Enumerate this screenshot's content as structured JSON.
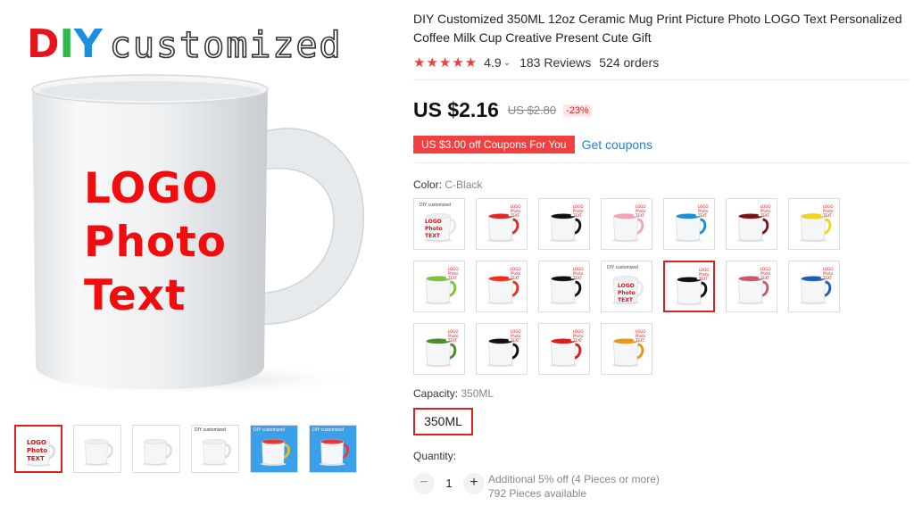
{
  "gallery": {
    "banner_diy": [
      "D",
      "I",
      "Y"
    ],
    "banner_word": "customized",
    "mug_text": [
      "LOGO",
      "Photo",
      "Text"
    ],
    "thumbnails": [
      {
        "name": "thumb-logo-mug",
        "active": true
      },
      {
        "name": "thumb-mug-dimensions",
        "active": false
      },
      {
        "name": "thumb-plain-mug",
        "active": false
      },
      {
        "name": "thumb-cartoon-mug",
        "active": false
      },
      {
        "name": "thumb-color-mugs-blue",
        "active": false
      },
      {
        "name": "thumb-color-mugs-set",
        "active": false
      }
    ]
  },
  "product": {
    "title": "DIY Customized 350ML 12oz Ceramic Mug Print Picture Photo LOGO Text Personalized Coffee Milk Cup Creative Present Cute Gift",
    "stars": "★★★★★",
    "rating": "4.9",
    "reviews": "183 Reviews",
    "orders": "524 orders",
    "price": "US $2.16",
    "old_price": "US $2.80",
    "discount": "-23%",
    "coupon": "US $3.00 off Coupons For You",
    "get_coupons": "Get coupons"
  },
  "color": {
    "label": "Color:",
    "value": "C-Black",
    "swatches": [
      {
        "handle": "#ffffff",
        "type": "logo"
      },
      {
        "handle": "#e02727",
        "type": "inner"
      },
      {
        "handle": "#111111",
        "type": "inner"
      },
      {
        "handle": "#f2a3b5",
        "type": "inner"
      },
      {
        "handle": "#1a8fd6",
        "type": "inner"
      },
      {
        "handle": "#7a1414",
        "type": "inner"
      },
      {
        "handle": "#f5d21c",
        "type": "inner"
      },
      {
        "handle": "#7cc23a",
        "type": "inner"
      },
      {
        "handle": "#ee2f1e",
        "type": "inner"
      },
      {
        "handle": "#111111",
        "type": "plain"
      },
      {
        "handle": "#ffffff",
        "type": "logo2"
      },
      {
        "handle": "#111111",
        "type": "selected"
      },
      {
        "handle": "#c75a6a",
        "type": "inner"
      },
      {
        "handle": "#1c5fb3",
        "type": "inner"
      },
      {
        "handle": "#4f8a2a",
        "type": "inner"
      },
      {
        "handle": "#111111",
        "type": "inner"
      },
      {
        "handle": "#d91c1c",
        "type": "inner"
      },
      {
        "handle": "#e39a1c",
        "type": "inner"
      }
    ]
  },
  "capacity": {
    "label": "Capacity:",
    "value": "350ML",
    "option": "350ML"
  },
  "quantity": {
    "label": "Quantity:",
    "minus": "−",
    "plus": "+",
    "value": "1",
    "note1": "Additional 5% off (4 Pieces or more)",
    "note2": "792 Pieces available"
  },
  "swatch_text": [
    "LOGO",
    "Photo",
    "TEXT"
  ],
  "thumb_text": "DIY customized"
}
